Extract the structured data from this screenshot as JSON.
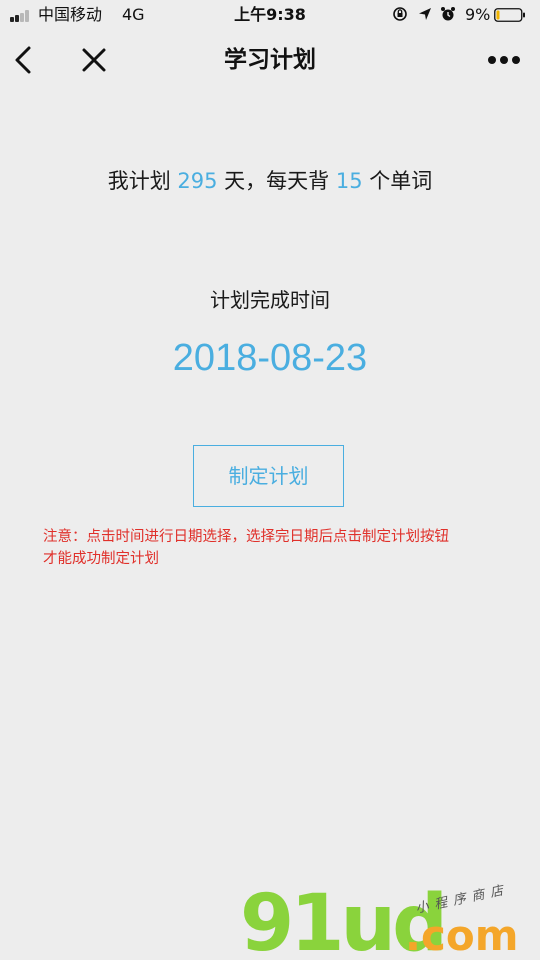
{
  "status_bar": {
    "carrier": "中国移动",
    "network": "4G",
    "time": "上午9:38",
    "battery_percent": "9%",
    "icons": [
      "signal-icon",
      "orientation-lock-icon",
      "location-icon",
      "alarm-icon",
      "battery-icon"
    ]
  },
  "nav": {
    "title": "学习计划",
    "back_icon": "chevron-left-icon",
    "close_icon": "close-icon",
    "more_icon": "more-dots-icon"
  },
  "plan": {
    "prefix": "我计划 ",
    "days": "295",
    "middle": " 天，每天背 ",
    "words_per_day": "15",
    "suffix": " 个单词"
  },
  "finish": {
    "label": "计划完成时间",
    "date": "2018-08-23"
  },
  "actions": {
    "make_plan_label": "制定计划"
  },
  "note": {
    "line1": "注意：点击时间进行日期选择，选择完日期后点击制定计划按钮",
    "line2": "才能成功制定计划"
  },
  "watermark": {
    "logo": "91ud",
    "domain": ".com",
    "tagline": "小程序商店"
  },
  "colors": {
    "accent": "#4aaee0",
    "warning": "#e0302a",
    "background": "#ededed"
  }
}
